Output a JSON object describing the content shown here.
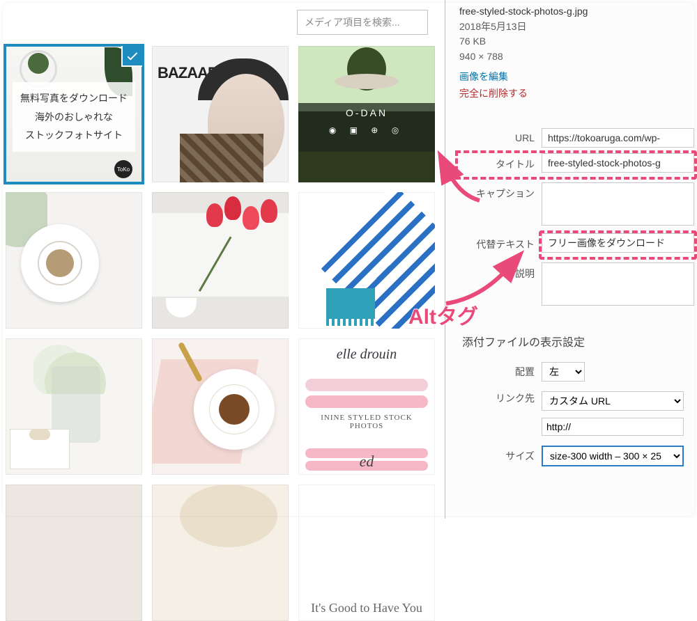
{
  "search": {
    "placeholder": "メディア項目を検索..."
  },
  "thumb1": {
    "line1": "無料写真をダウンロード",
    "line2": "海外のおしゃれな",
    "line3": "ストックフォトサイト",
    "badge": "ToKo"
  },
  "thumb2": {
    "mag": "BAZAAR"
  },
  "thumb3": {
    "brand": "O-DAN",
    "icons": "◉ ▣ ⊕ ◎"
  },
  "thumb9": {
    "title": "elle drouin",
    "mid": "ININE STYLED STOCK PHOTOS",
    "sig": "ed"
  },
  "thumb12": {
    "text": "It's Good to Have You"
  },
  "details": {
    "filename": "free-styled-stock-photos-g.jpg",
    "date": "2018年5月13日",
    "size": "76 KB",
    "dims": "940 × 788",
    "edit": "画像を編集",
    "delete": "完全に削除する"
  },
  "fields": {
    "url_label": "URL",
    "url_value": "https://tokoaruga.com/wp-",
    "title_label": "タイトル",
    "title_value": "free-styled-stock-photos-g",
    "caption_label": "キャプション",
    "caption_value": "",
    "alt_label": "代替テキスト",
    "alt_value": "フリー画像をダウンロード",
    "desc_label": "説明",
    "desc_value": ""
  },
  "display": {
    "heading": "添付ファイルの表示設定",
    "align_label": "配置",
    "align_value": "左",
    "link_label": "リンク先",
    "link_value": "カスタム URL",
    "http_value": "http://",
    "size_label": "サイズ",
    "size_value": "size-300 width – 300 × 25"
  },
  "annotation": {
    "alt_tag": "Altタグ"
  }
}
